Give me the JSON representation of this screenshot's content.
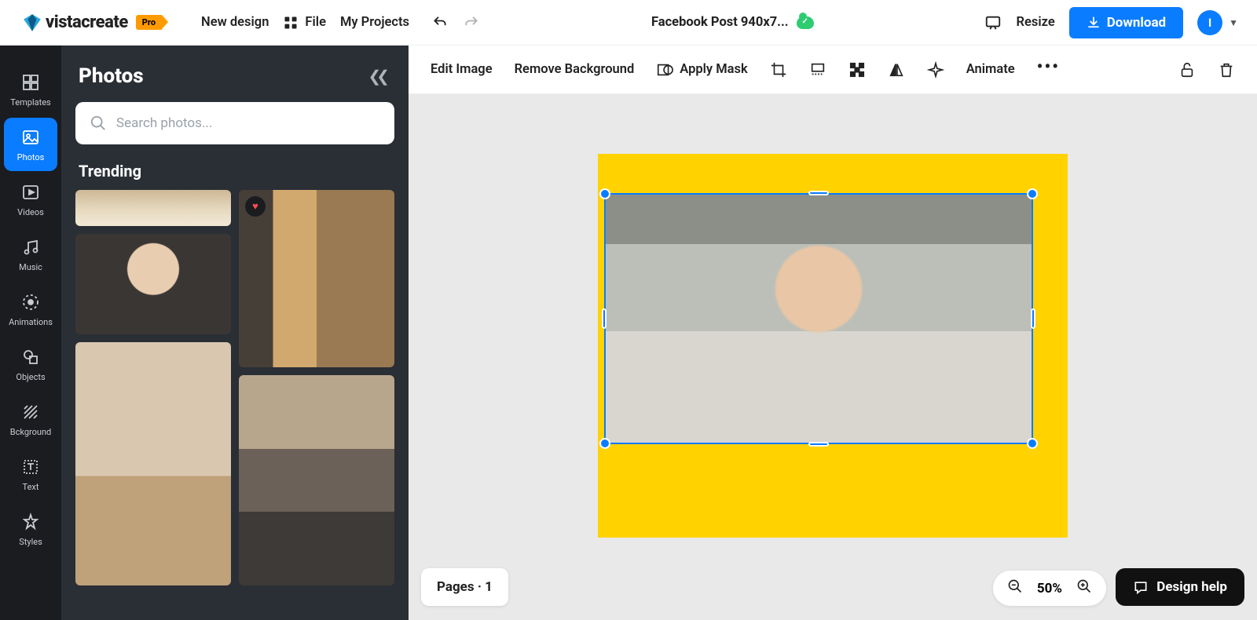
{
  "header": {
    "brand": "vistacreate",
    "pro_badge": "Pro",
    "new_design": "New design",
    "file": "File",
    "my_projects": "My Projects",
    "doc_title": "Facebook Post 940x7...",
    "resize": "Resize",
    "download": "Download",
    "avatar_initial": "I"
  },
  "rail": {
    "items": [
      {
        "id": "templates",
        "label": "Templates"
      },
      {
        "id": "photos",
        "label": "Photos"
      },
      {
        "id": "videos",
        "label": "Videos"
      },
      {
        "id": "music",
        "label": "Music"
      },
      {
        "id": "animations",
        "label": "Animations"
      },
      {
        "id": "objects",
        "label": "Objects"
      },
      {
        "id": "background",
        "label": "Bckground"
      },
      {
        "id": "text",
        "label": "Text"
      },
      {
        "id": "styles",
        "label": "Styles"
      }
    ],
    "active": "photos"
  },
  "panel": {
    "title": "Photos",
    "search_placeholder": "Search photos...",
    "section": "Trending"
  },
  "toolbar": {
    "edit_image": "Edit Image",
    "remove_bg": "Remove Background",
    "apply_mask": "Apply Mask",
    "animate": "Animate"
  },
  "footer": {
    "pages_label": "Pages · 1",
    "zoom_label": "50%",
    "help_label": "Design help"
  }
}
